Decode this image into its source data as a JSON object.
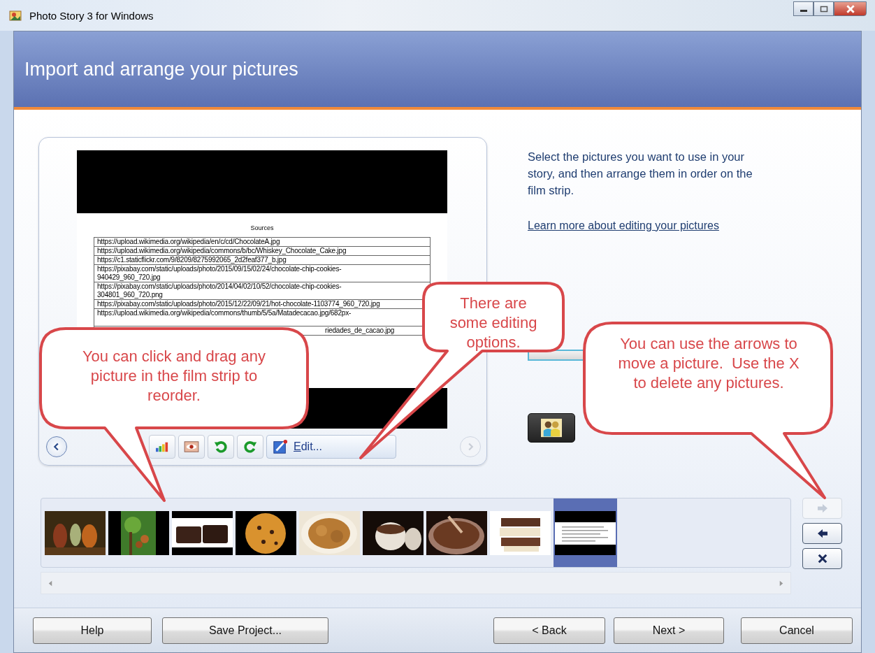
{
  "window": {
    "title": "Photo Story 3 for Windows"
  },
  "header": {
    "title": "Import and arrange your pictures"
  },
  "preview": {
    "prev_disabled": false,
    "next_disabled": true,
    "edit_button": "Edit...",
    "document": {
      "heading": "Sources",
      "rows": [
        {
          "lines": [
            "https://upload.wikimedia.org/wikipedia/en/c/cd/ChocolateA.jpg"
          ]
        },
        {
          "lines": [
            "https://upload.wikimedia.org/wikipedia/commons/b/bc/Whiskey_Chocolate_Cake.jpg"
          ]
        },
        {
          "lines": [
            "https://c1.staticflickr.com/9/8209/8275992065_2d2feaf377_b.jpg"
          ]
        },
        {
          "lines": [
            "https://pixabay.com/static/uploads/photo/2015/09/15/02/24/chocolate-chip-cookies-",
            "940429_960_720.jpg"
          ]
        },
        {
          "lines": [
            "https://pixabay.com/static/uploads/photo/2014/04/02/10/52/chocolate-chip-cookies-",
            "304801_960_720.png"
          ]
        },
        {
          "lines": [
            "https://pixabay.com/static/uploads/photo/2015/12/22/09/21/hot-chocolate-1103774_960_720.jpg"
          ]
        },
        {
          "lines": [
            "https://upload.wikimedia.org/wikipedia/commons/thumb/5/5a/Matadecacao.jpg/682px-"
          ]
        },
        {
          "lines": [
            "riedades_de_cacao.jpg"
          ],
          "kind": "covered"
        }
      ]
    }
  },
  "instructions": {
    "text": "Select the pictures you want to use in your story, and then arrange them in order on the film strip.",
    "link": "Learn more about editing your pictures"
  },
  "filmstrip": {
    "thumbnails": [
      {
        "kind": "picture",
        "selected": false
      },
      {
        "kind": "picture",
        "selected": false
      },
      {
        "kind": "picture",
        "selected": false
      },
      {
        "kind": "picture",
        "selected": false
      },
      {
        "kind": "picture",
        "selected": false
      },
      {
        "kind": "picture",
        "selected": false
      },
      {
        "kind": "picture",
        "selected": false
      },
      {
        "kind": "picture",
        "selected": false
      },
      {
        "kind": "document",
        "selected": true
      }
    ]
  },
  "move_buttons": [
    {
      "kind": "right",
      "disabled": true
    },
    {
      "kind": "left",
      "disabled": false
    },
    {
      "kind": "delete",
      "disabled": false
    }
  ],
  "buttons": [
    {
      "label": "Help"
    },
    {
      "label": "Save Project..."
    },
    {
      "label": "< Back"
    },
    {
      "label": "Next >"
    },
    {
      "label": "Cancel"
    }
  ],
  "callouts": [
    {
      "text": "You can click and drag any picture in the film strip to reorder."
    },
    {
      "text": "There are some editing options."
    },
    {
      "text": "You can use the arrows to move a picture.  Use the X to delete any pictures."
    }
  ]
}
